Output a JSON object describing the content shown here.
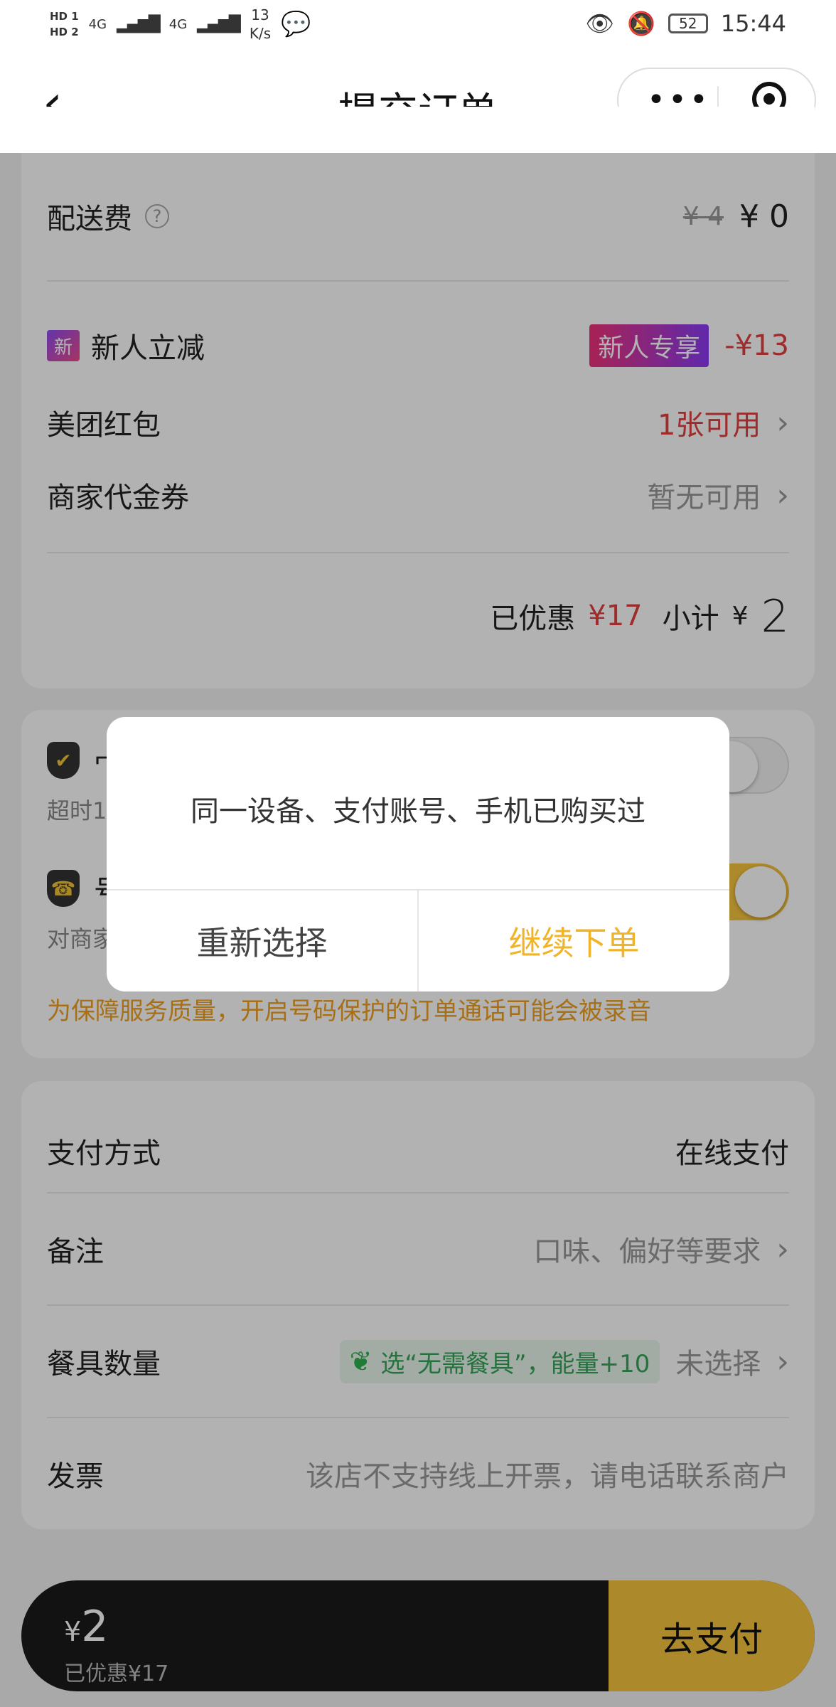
{
  "status_bar": {
    "hd1": "HD 1",
    "hd2": "HD 2",
    "net1": "4G",
    "net2": "4G",
    "speed_value": "13",
    "speed_unit": "K/s",
    "battery": "52",
    "time": "15:44"
  },
  "nav": {
    "title": "提交订单"
  },
  "fees": {
    "delivery_label": "配送费",
    "delivery_original": "¥ 4",
    "delivery_current": "¥ 0"
  },
  "discounts": {
    "new_user_icon": "新",
    "new_user_label": "新人立减",
    "new_user_badge": "新人专享",
    "new_user_amount": "-¥13",
    "redpacket_label": "美团红包",
    "redpacket_value": "1张可用",
    "voucher_label": "商家代金券",
    "voucher_value": "暂无可用",
    "saved_label": "已优惠",
    "saved_amount": "¥17",
    "subtotal_label": "小计",
    "subtotal_yen": "¥",
    "subtotal_amount": "2"
  },
  "service": {
    "row1_title": "冖",
    "row1_sub": "超时1",
    "row2_title": "号",
    "row2_sub": "对商家",
    "notice": "为保障服务质量，开启号码保护的订单通话可能会被录音"
  },
  "order_info": {
    "pay_label": "支付方式",
    "pay_value": "在线支付",
    "remark_label": "备注",
    "remark_value": "口味、偏好等要求",
    "tableware_label": "餐具数量",
    "tableware_eco": "选“无需餐具”，能量+10",
    "tableware_value": "未选择",
    "invoice_label": "发票",
    "invoice_value": "该店不支持线上开票，请电话联系商户"
  },
  "paybar": {
    "yen": "¥",
    "amount": "2",
    "saved": "已优惠¥17",
    "pay_button": "去支付"
  },
  "dialog": {
    "message": "同一设备、支付账号、手机已购买过",
    "reselect": "重新选择",
    "continue": "继续下单"
  },
  "colors": {
    "accent": "#f0b429",
    "red": "#e43f3f"
  }
}
